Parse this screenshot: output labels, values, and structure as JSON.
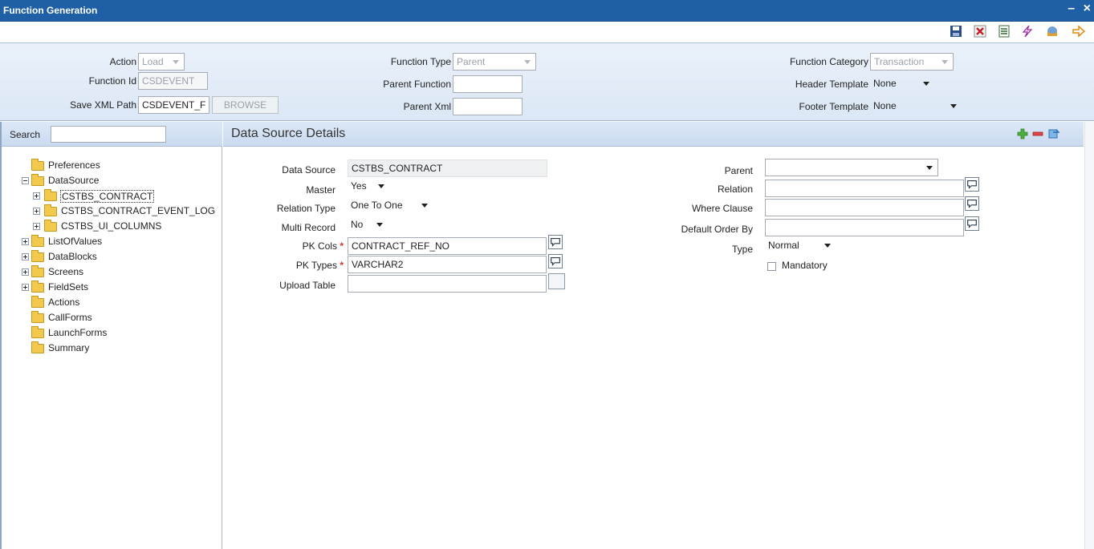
{
  "window": {
    "title": "Function Generation",
    "minimize": "–",
    "close": "×"
  },
  "toolbar": {
    "icons": [
      "save-icon",
      "delete-icon",
      "list-icon",
      "generate-icon",
      "release-icon",
      "exit-icon"
    ]
  },
  "header": {
    "action": {
      "label": "Action",
      "value": "Load"
    },
    "function_id": {
      "label": "Function Id",
      "value": "CSDEVENT"
    },
    "save_xml_path": {
      "label": "Save XML Path",
      "value": "CSDEVENT_F",
      "browse": "BROWSE"
    },
    "function_type": {
      "label": "Function Type",
      "value": "Parent"
    },
    "parent_function": {
      "label": "Parent Function",
      "value": ""
    },
    "parent_xml": {
      "label": "Parent Xml",
      "value": ""
    },
    "function_category": {
      "label": "Function Category",
      "value": "Transaction"
    },
    "header_template": {
      "label": "Header Template",
      "value": "None"
    },
    "footer_template": {
      "label": "Footer Template",
      "value": "None"
    }
  },
  "sidebar": {
    "search_label": "Search",
    "search_value": "",
    "tree": [
      {
        "label": "Preferences"
      },
      {
        "label": "DataSource"
      },
      {
        "label": "CSTBS_CONTRACT"
      },
      {
        "label": "CSTBS_CONTRACT_EVENT_LOG"
      },
      {
        "label": "CSTBS_UI_COLUMNS"
      },
      {
        "label": "ListOfValues"
      },
      {
        "label": "DataBlocks"
      },
      {
        "label": "Screens"
      },
      {
        "label": "FieldSets"
      },
      {
        "label": "Actions"
      },
      {
        "label": "CallForms"
      },
      {
        "label": "LaunchForms"
      },
      {
        "label": "Summary"
      }
    ]
  },
  "details": {
    "title": "Data Source Details",
    "data_source": {
      "label": "Data Source",
      "value": "CSTBS_CONTRACT"
    },
    "master": {
      "label": "Master",
      "value": "Yes"
    },
    "relation_type": {
      "label": "Relation Type",
      "value": "One To One"
    },
    "multi_record": {
      "label": "Multi Record",
      "value": "No"
    },
    "pk_cols": {
      "label": "PK Cols",
      "required": "*",
      "value": "CONTRACT_REF_NO"
    },
    "pk_types": {
      "label": "PK Types",
      "required": "*",
      "value": "VARCHAR2"
    },
    "upload_table": {
      "label": "Upload Table",
      "value": ""
    },
    "parent": {
      "label": "Parent",
      "value": ""
    },
    "relation": {
      "label": "Relation",
      "value": ""
    },
    "where_clause": {
      "label": "Where Clause",
      "value": ""
    },
    "default_order_by": {
      "label": "Default Order By",
      "value": ""
    },
    "type": {
      "label": "Type",
      "value": "Normal"
    },
    "mandatory": {
      "label": "Mandatory",
      "checked": false
    }
  },
  "colors": {
    "titlebar": "#1f5fa6",
    "header_bg": "#dbe7f5",
    "required": "#c0392b"
  }
}
